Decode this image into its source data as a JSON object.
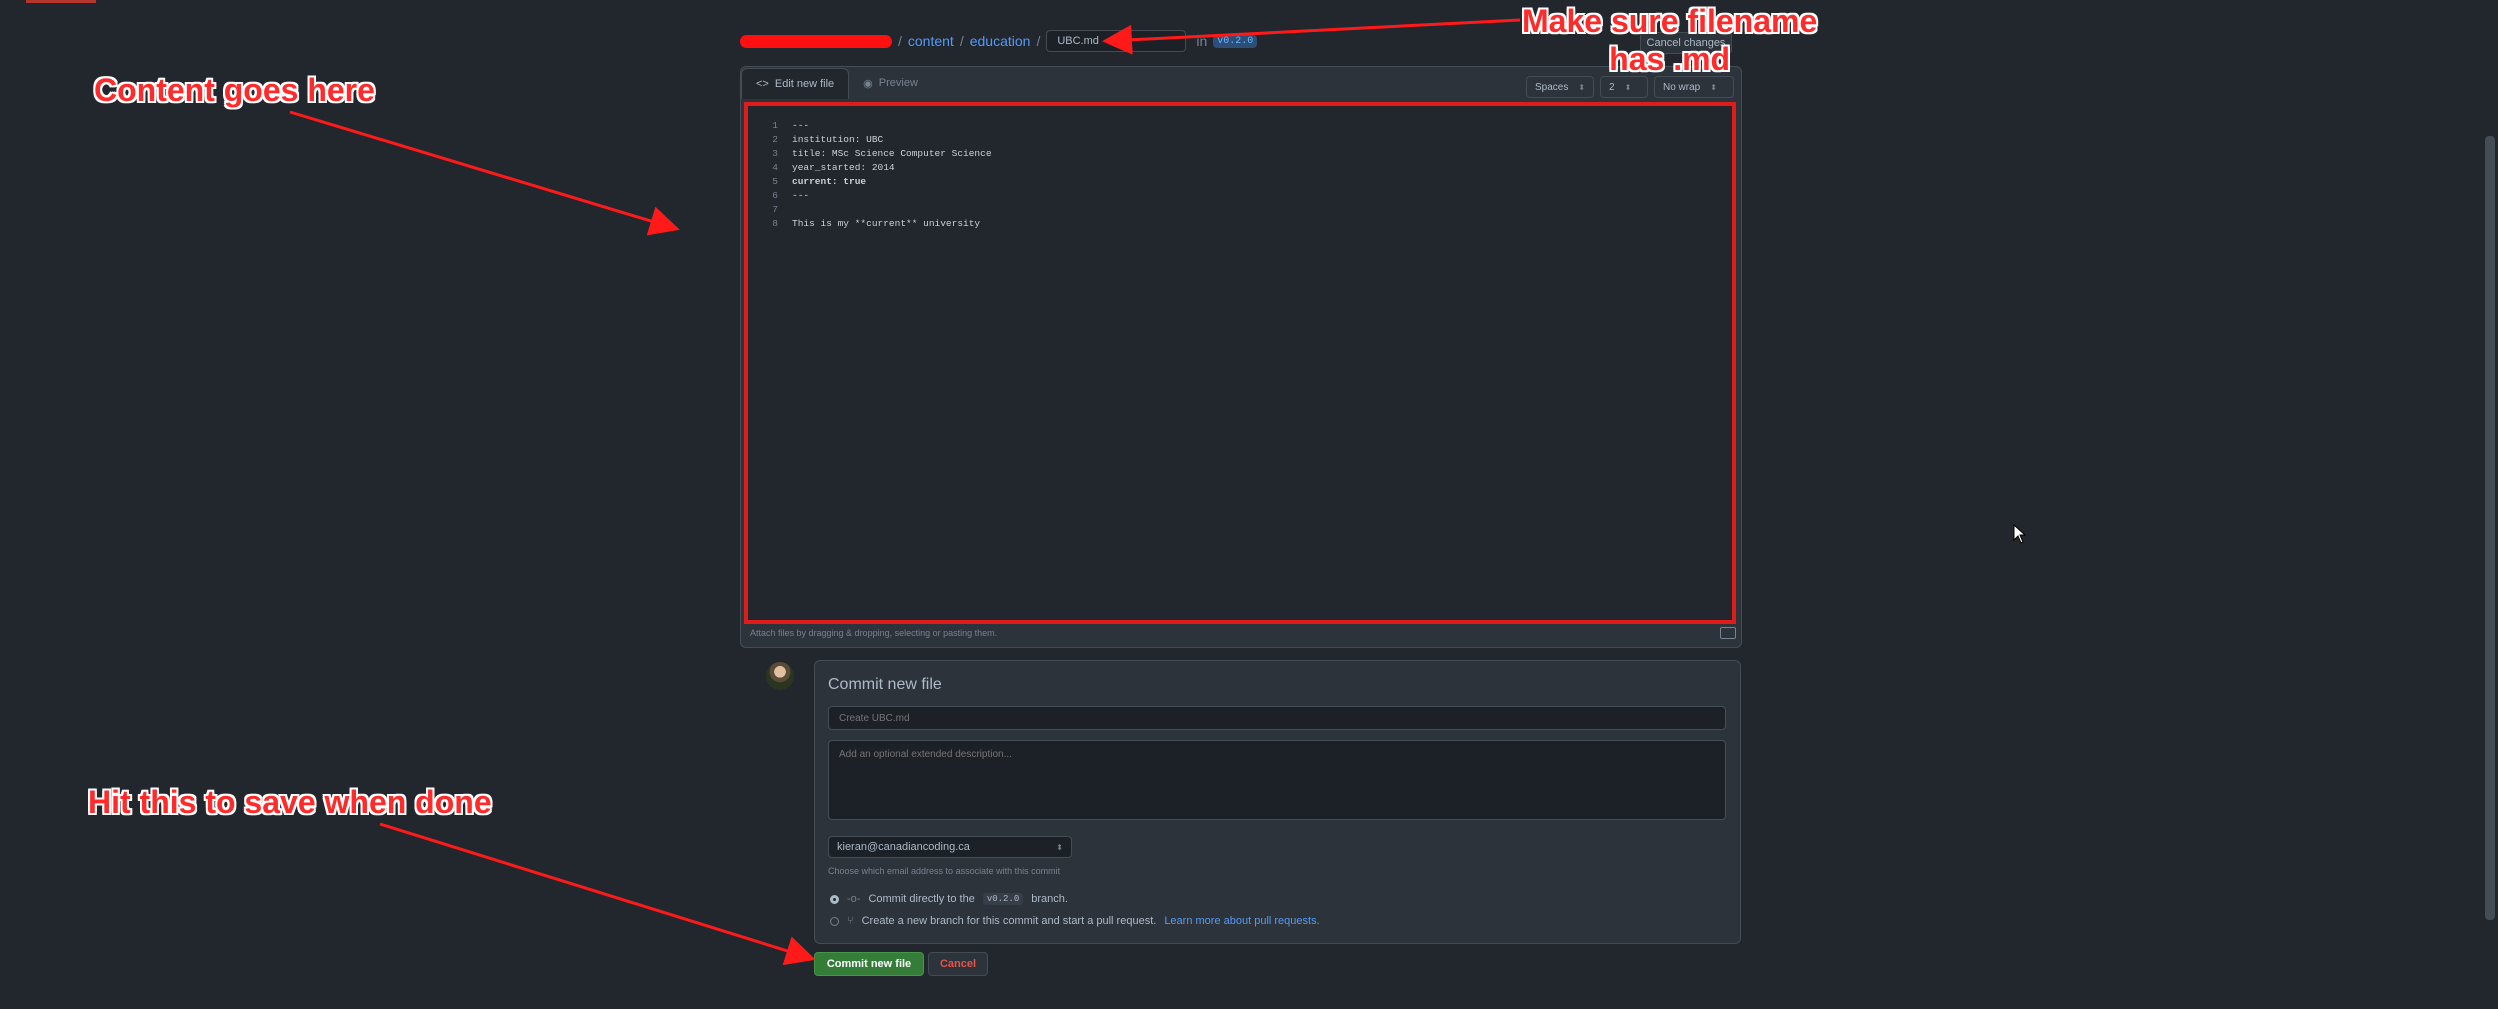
{
  "path": {
    "crumbs": [
      "content",
      "education"
    ],
    "separator": "/",
    "filename_value": "UBC.md",
    "in_label": "in",
    "branch": "v0.2.0",
    "cancel_changes": "Cancel changes"
  },
  "editor": {
    "tab_edit": "Edit new file",
    "tab_preview": "Preview",
    "indent_mode": "Spaces",
    "indent_size": "2",
    "wrap_mode": "No wrap",
    "lines": [
      {
        "n": "1",
        "text": "---"
      },
      {
        "n": "2",
        "text": "institution: UBC"
      },
      {
        "n": "3",
        "text": "title: MSc Science Computer Science"
      },
      {
        "n": "4",
        "text": "year_started: 2014"
      },
      {
        "n": "5",
        "text": "current: true"
      },
      {
        "n": "6",
        "text": "---"
      },
      {
        "n": "7",
        "text": ""
      },
      {
        "n": "8",
        "text": "This is my **current** university"
      }
    ],
    "attach_hint": "Attach files by dragging & dropping, selecting or pasting them."
  },
  "commit": {
    "title": "Commit new file",
    "summary_placeholder": "Create UBC.md",
    "description_placeholder": "Add an optional extended description...",
    "email": "kieran@canadiancoding.ca",
    "email_help": "Choose which email address to associate with this commit",
    "option1_prefix": "Commit directly to the",
    "option1_branch": "v0.2.0",
    "option1_suffix": "branch.",
    "option2_text": "Create a new branch for this commit and start a pull request.",
    "option2_link": "Learn more about pull requests.",
    "submit": "Commit new file",
    "cancel": "Cancel"
  },
  "annotations": {
    "content": "Content goes here",
    "filename_line1": "Make sure filename",
    "filename_line2": "has .md",
    "save": "Hit this to save when done",
    "color": "#ff2a2a"
  }
}
